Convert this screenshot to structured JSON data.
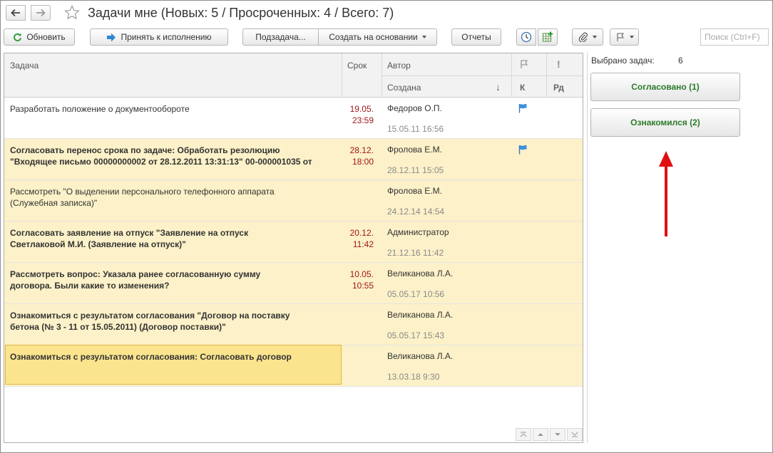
{
  "window": {
    "title": "Задачи мне (Новых: 5 / Просроченных: 4 / Всего: 7)"
  },
  "toolbar": {
    "refresh_label": "Обновить",
    "accept_label": "Принять к исполнению",
    "subtask_label": "Подзадача...",
    "create_based_label": "Создать на основании",
    "reports_label": "Отчеты",
    "search_placeholder": "Поиск (Ctrl+F)"
  },
  "table": {
    "headers": {
      "task": "Задача",
      "due": "Срок",
      "author": "Автор",
      "created": "Создана",
      "k": "К",
      "rd": "Рд"
    },
    "rows": [
      {
        "task_line1": "Разработать положение о документообороте",
        "task_line2": "",
        "due": "19.05.\n23:59",
        "author": "Федоров О.П.",
        "created": "15.05.11 16:56",
        "flag": true,
        "bold": false,
        "highlight": false
      },
      {
        "task_line1": "Согласовать перенос срока по задаче: Обработать резолюцию",
        "task_line2": "\"Входящее письмо 00000000002 от 28.12.2011 13:31:13\" 00-000001035 от",
        "due": "28.12.\n18:00",
        "author": "Фролова Е.М.",
        "created": "28.12.11 15:05",
        "flag": true,
        "bold": true,
        "highlight": true
      },
      {
        "task_line1": "Рассмотреть \"О выделении персонального телефонного аппарата",
        "task_line2": "(Служебная записка)\"",
        "due": "",
        "author": "Фролова Е.М.",
        "created": "24.12.14 14:54",
        "flag": false,
        "bold": false,
        "highlight": true
      },
      {
        "task_line1": "Согласовать заявление на отпуск \"Заявление на отпуск",
        "task_line2": "Светлаковой М.И. (Заявление на отпуск)\"",
        "due": "20.12.\n11:42",
        "author": "Администратор",
        "created": "21.12.16 11:42",
        "flag": false,
        "bold": true,
        "highlight": true
      },
      {
        "task_line1": "Рассмотреть вопрос: Указала ранее согласованную сумму",
        "task_line2": "договора. Были какие то изменения?",
        "due": "10.05.\n10:55",
        "author": "Великанова Л.А.",
        "created": "05.05.17 10:56",
        "flag": false,
        "bold": true,
        "highlight": true
      },
      {
        "task_line1": "Ознакомиться с результатом согласования \"Договор на поставку",
        "task_line2": "бетона (№ 3 - 11 от 15.05.2011) (Договор поставки)\"",
        "due": "",
        "author": "Великанова Л.А.",
        "created": "05.05.17 15:43",
        "flag": false,
        "bold": true,
        "highlight": true
      },
      {
        "task_line1": "Ознакомиться с результатом согласования: Согласовать договор",
        "task_line2": "",
        "due": "",
        "author": "Великанова Л.А.",
        "created": "13.03.18 9:30",
        "flag": false,
        "bold": true,
        "highlight": true,
        "selected": true
      }
    ]
  },
  "panel": {
    "selected_label": "Выбрано задач:",
    "selected_count": "6",
    "approved_button": "Согласовано (1)",
    "acknowledged_button": "Ознакомился (2)"
  },
  "colors": {
    "accent_green": "#2a7a2a",
    "highlight_row": "#fcf1c8",
    "selected_cell": "#fbe48e",
    "due_red": "#a01818",
    "arrow_red": "#e01010"
  }
}
